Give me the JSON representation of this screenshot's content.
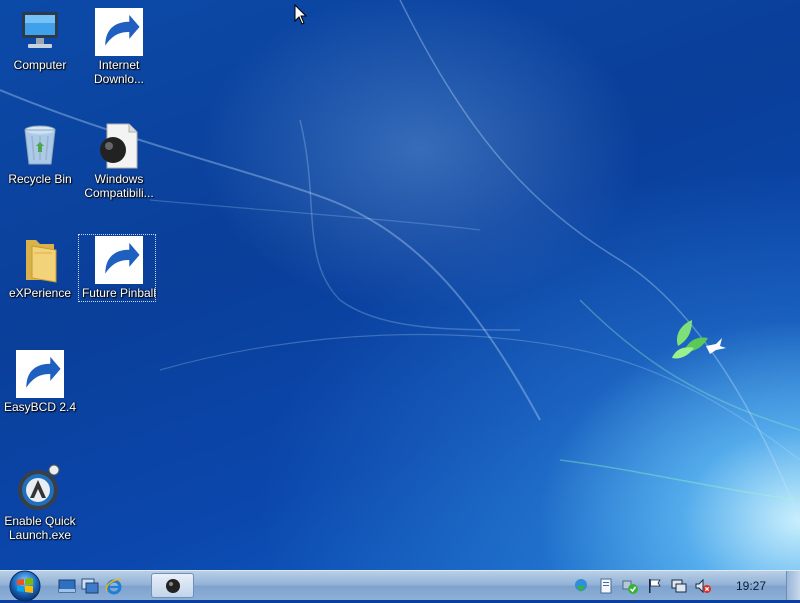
{
  "desktop_icons": [
    {
      "label": "Computer",
      "icon": "computer-icon",
      "shortcut": false
    },
    {
      "label": "Internet\nDownlo...",
      "icon": "internet-download-manager-icon",
      "shortcut": true
    },
    {
      "label": "Recycle Bin",
      "icon": "recycle-bin-icon",
      "shortcut": false
    },
    {
      "label": "Windows\nCompatibili...",
      "icon": "windows-compatibility-icon",
      "shortcut": false
    },
    {
      "label": "eXPerience",
      "icon": "folder-icon",
      "shortcut": false
    },
    {
      "label": "Future Pinball",
      "icon": "future-pinball-icon",
      "shortcut": true,
      "selected": true
    },
    {
      "label": "EasyBCD 2.4",
      "icon": "easybcd-icon",
      "shortcut": true
    },
    {
      "label": "Enable Quick\nLaunch.exe",
      "icon": "quick-launch-exe-icon",
      "shortcut": false
    }
  ],
  "taskbar": {
    "start_icon": "windows-orb-icon",
    "quick_launch": [
      "show-desktop-icon",
      "switch-windows-icon",
      "internet-explorer-icon"
    ],
    "running_tasks": [
      "future-pinball-icon"
    ],
    "tray_icons": [
      "download-manager-tray-icon",
      "document-tray-icon",
      "security-check-icon",
      "action-center-flag-icon",
      "network-icon",
      "volume-muted-icon"
    ],
    "clock": "19:27"
  },
  "colors": {
    "wallpaper": "#0a3f9c",
    "taskbar": "#8fb0d6",
    "text": "#ffffff"
  }
}
